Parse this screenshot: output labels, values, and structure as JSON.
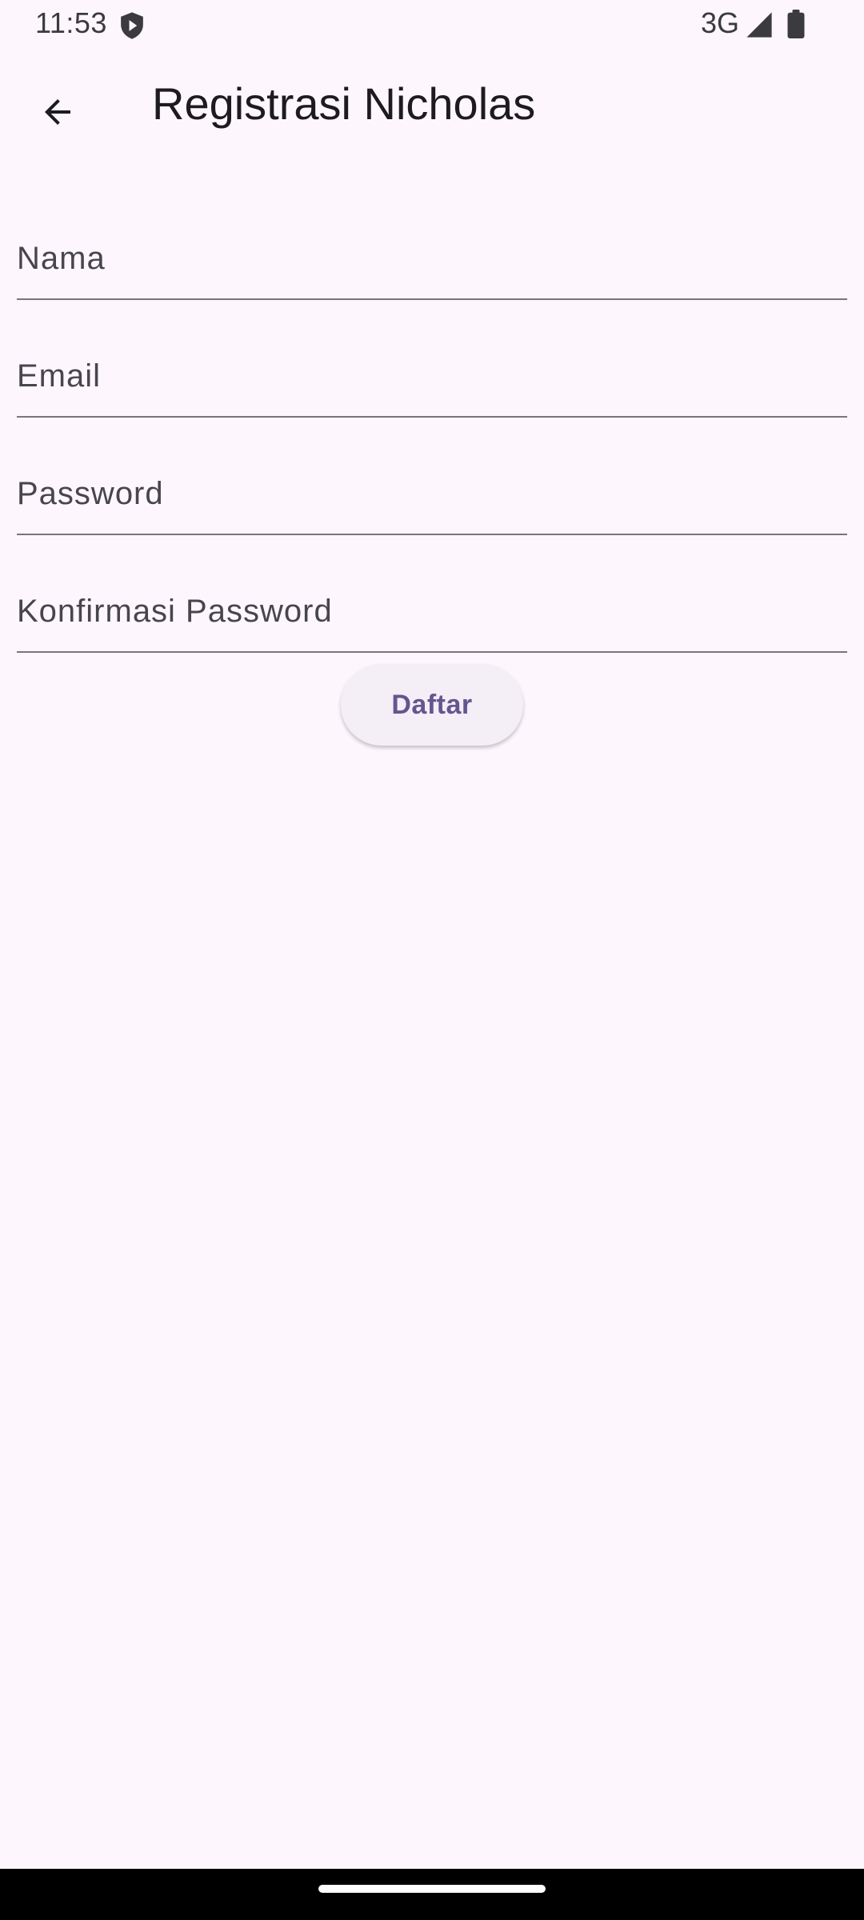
{
  "status_bar": {
    "time": "11:53",
    "network": "3G",
    "icons": [
      "shield-icon",
      "signal-icon",
      "battery-icon"
    ]
  },
  "app_bar": {
    "title": "Registrasi Nicholas",
    "back_icon": "arrow-back-icon"
  },
  "form": {
    "fields": [
      {
        "label": "Nama",
        "value": ""
      },
      {
        "label": "Email",
        "value": ""
      },
      {
        "label": "Password",
        "value": ""
      },
      {
        "label": "Konfirmasi Password",
        "value": ""
      }
    ],
    "submit_label": "Daftar"
  },
  "colors": {
    "background": "#fdf7fd",
    "accent": "#65558f",
    "button_bg": "#f4eef6",
    "underline": "#79747e",
    "label": "#49454f",
    "nav_bar": "#000000"
  }
}
